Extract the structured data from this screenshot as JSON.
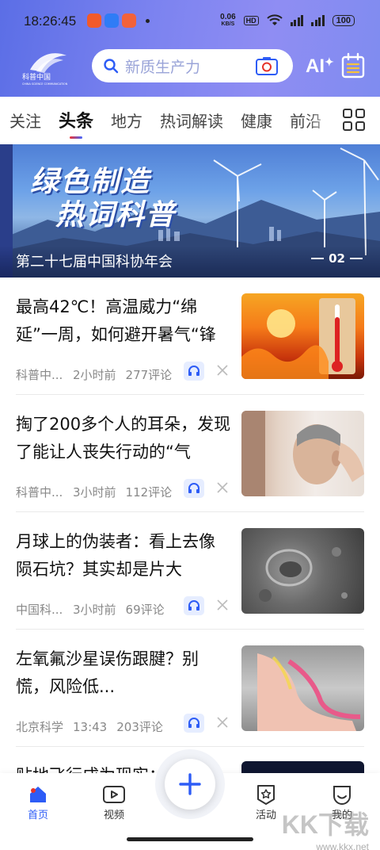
{
  "status": {
    "time": "18:26:45",
    "net_speed_value": "0.06",
    "net_speed_unit": "KB/S",
    "hd": "HD",
    "battery": "100"
  },
  "logo": {
    "alt": "科普中国",
    "sub": "CHINA SCIENCE COMMUNICATION"
  },
  "search": {
    "placeholder": "新质生产力"
  },
  "header": {
    "ai_label": "AI"
  },
  "tabs": [
    "关注",
    "头条",
    "地方",
    "热词解读",
    "健康",
    "前沿"
  ],
  "active_tab": 1,
  "banner": {
    "line1": "绿色制造",
    "line2": "热词科普",
    "caption": "第二十七届中国科协年会",
    "index": "02"
  },
  "news": [
    {
      "title": "最高42℃！高温威力“绵延”一周，如何避开暑气“锋",
      "source": "科普中...",
      "time": "2小时前",
      "comments": "277评论",
      "thumb": "heat"
    },
    {
      "title": "掏了200多个人的耳朵，发现了能让人丧失行动的“气",
      "source": "科普中...",
      "time": "3小时前",
      "comments": "112评论",
      "thumb": "ear"
    },
    {
      "title": "月球上的伪装者：看上去像陨石坑？其实却是片大",
      "source": "中国科...",
      "time": "3小时前",
      "comments": "69评论",
      "thumb": "moon"
    },
    {
      "title": "左氧氟沙星误伤跟腱？别慌，风险低...",
      "source": "北京科学...",
      "time": "13:43",
      "comments": "203评论",
      "thumb": "tendon"
    }
  ],
  "peek_title": "贴地飞行成为现实：",
  "bottom_nav": [
    {
      "label": "首页",
      "icon": "home-icon",
      "active": true
    },
    {
      "label": "视频",
      "icon": "video-icon",
      "active": false
    },
    {
      "label": "活动",
      "icon": "badge-icon",
      "active": false
    },
    {
      "label": "我的",
      "icon": "profile-icon",
      "active": false
    }
  ],
  "watermark": {
    "brand": "KK下载",
    "url": "www.kkx.net"
  },
  "colors": {
    "accent": "#2d5cf6",
    "header_start": "#5b6ee6",
    "header_end": "#8f8df3"
  }
}
